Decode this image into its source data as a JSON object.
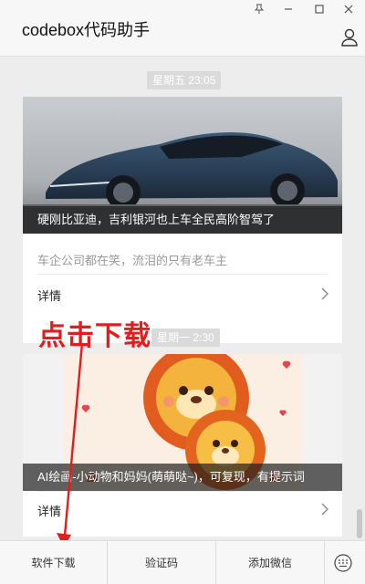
{
  "app": {
    "title": "codebox代码助手"
  },
  "window_controls": [
    "pin-icon",
    "minimize-icon",
    "maximize-icon",
    "close-icon"
  ],
  "feed": [
    {
      "time": "星期五 23:05",
      "caption": "硬刚比亚迪，吉利银河也上车全民高阶智驾了",
      "subtitle": "车企公司都在笑，流泪的只有老车主",
      "detail_label": "详情"
    },
    {
      "time": "星期一 2:30",
      "caption": "AI绘画-小动物和妈妈(萌萌哒~)，可复现，有提示词",
      "detail_label": "详情"
    }
  ],
  "annotation": {
    "text": "点击下载",
    "color": "#e21d1d"
  },
  "bottom_menu": [
    {
      "label": "软件下载"
    },
    {
      "label": "验证码"
    },
    {
      "label": "添加微信"
    }
  ]
}
